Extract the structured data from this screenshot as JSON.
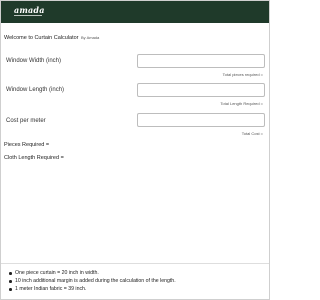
{
  "header": {
    "logo_text": "amada",
    "brand_color": "#1f3a2a"
  },
  "intro": {
    "title": "Welcome to Curtain Calculator",
    "byline": "By Amada"
  },
  "form": {
    "window_width": {
      "label": "Window Width (inch)",
      "value": "",
      "hint": "Total pieces required ="
    },
    "window_length": {
      "label": "Window Length (inch)",
      "value": "",
      "hint": "Total Length Required ="
    },
    "cost_per_meter": {
      "label": "Cost per meter",
      "value": "",
      "hint": "Total Cost ="
    }
  },
  "results": {
    "pieces_required": "Pieces Required =",
    "cloth_length_required": "Cloth Length Required ="
  },
  "notes": [
    "One piece curtain = 20 inch in width.",
    "10 inch additional margin is added during the calculation of the length.",
    "1 meter Indian fabric = 39 inch."
  ]
}
